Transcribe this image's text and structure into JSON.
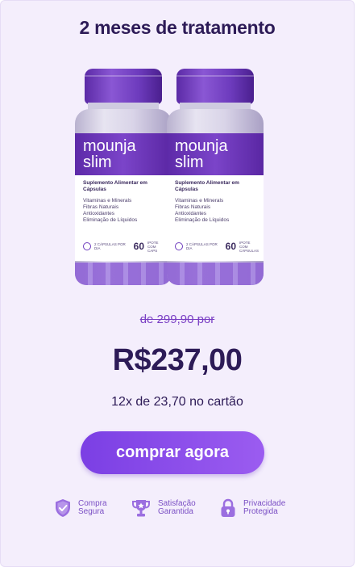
{
  "header": {
    "title": "2 meses de tratamento"
  },
  "product": {
    "bottles": [
      {
        "brand_line1": "mounja",
        "brand_line2": "slim",
        "supplement": "Suplemento Alimentar em Cápsulas",
        "features": [
          "Vitaminas e Minerals",
          "Fibras Naturais",
          "Antioxidantes",
          "Eliminação de Líquidos"
        ],
        "dose": "2 CÁPSULAS POR DIA",
        "count": "60",
        "count_label": "IPOTE COM CAPS"
      },
      {
        "brand_line1": "mounja",
        "brand_line2": "slim",
        "supplement": "Suplemento Alimentar em Cápsulas",
        "features": [
          "Vitaminas e Minerals",
          "Fibras Naturais",
          "Antioxidantes",
          "Eliminação de Líquidos"
        ],
        "dose": "2 CÁPSULAS POR DIA",
        "count": "60",
        "count_label": "IPOTE COM CÁPSULAS"
      }
    ]
  },
  "pricing": {
    "old_price": "de 299,90 por",
    "price": "R$237,00",
    "installments": "12x de 23,70 no cartão"
  },
  "cta": {
    "label": "comprar agora"
  },
  "badges": [
    {
      "icon": "shield-check-icon",
      "line1": "Compra",
      "line2": "Segura"
    },
    {
      "icon": "trophy-icon",
      "line1": "Satisfação",
      "line2": "Garantida"
    },
    {
      "icon": "lock-icon",
      "line1": "Privacidade",
      "line2": "Protegida"
    }
  ],
  "colors": {
    "background": "#f4eefc",
    "heading": "#2d1b57",
    "accent": "#7b3fe4",
    "old_price": "#7a3fc4"
  }
}
